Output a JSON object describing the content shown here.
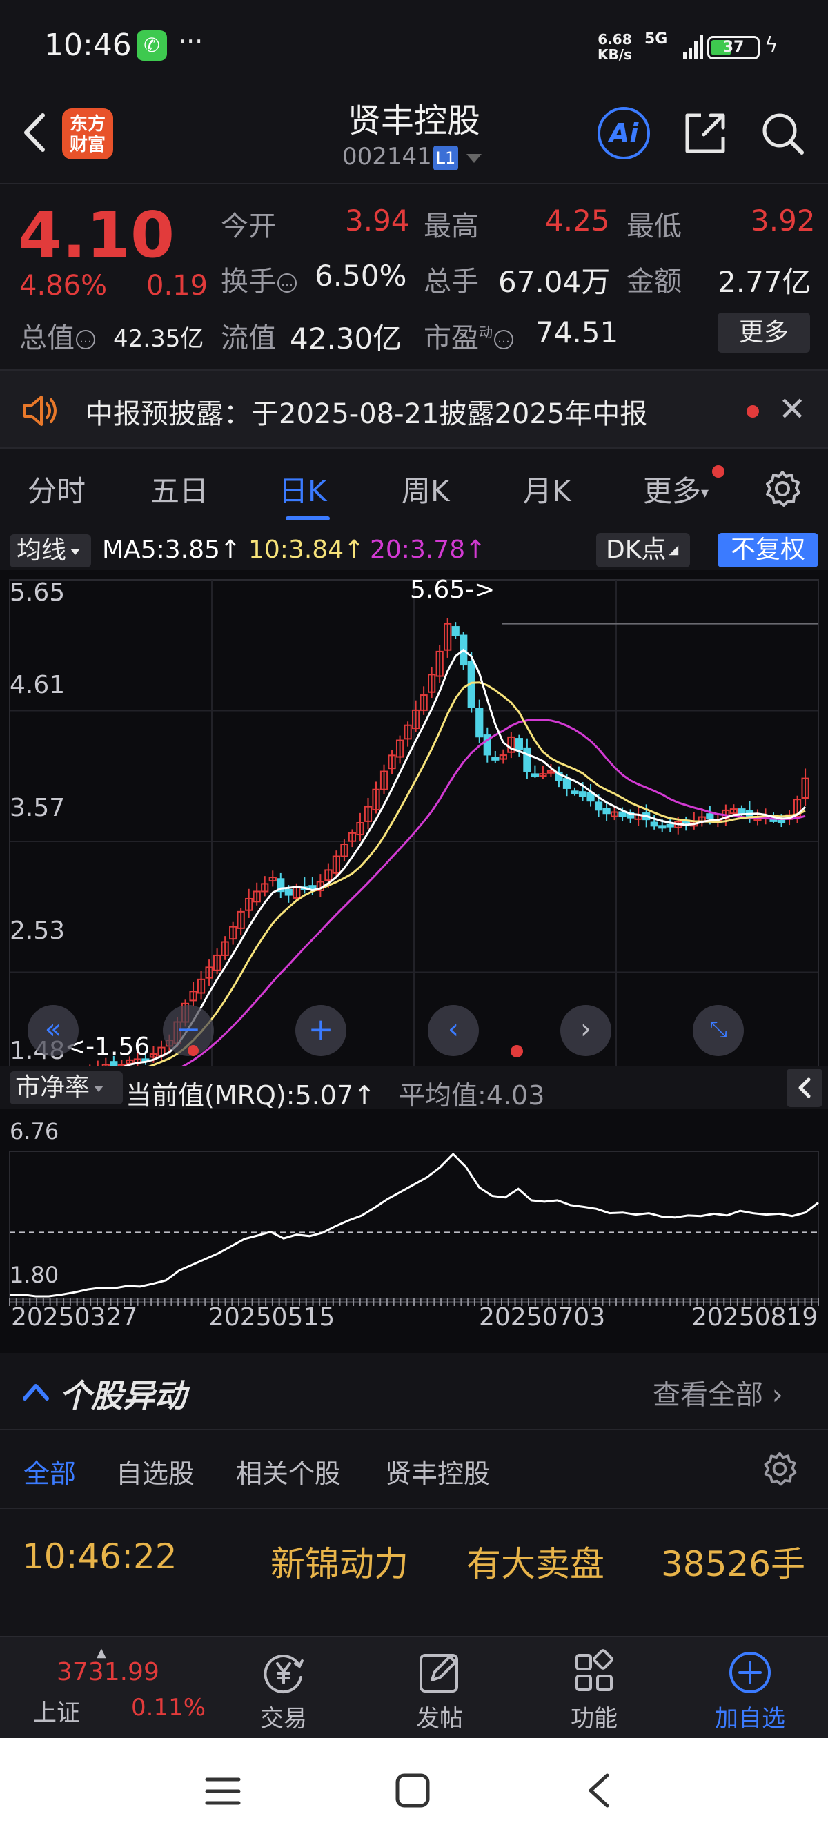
{
  "status_bar": {
    "time": "10:46",
    "more": "···",
    "net_speed": "6.68",
    "net_unit": "KB/s",
    "signal": "5G",
    "battery": "37"
  },
  "header": {
    "logo_line1": "东方",
    "logo_line2": "财富",
    "stock_name": "贤丰控股",
    "stock_code": "002141",
    "level_badge": "L1",
    "ai_label": "Ai"
  },
  "quote": {
    "price": "4.10",
    "change_pct": "4.86%",
    "change": "0.19",
    "open_label": "今开",
    "open": "3.94",
    "high_label": "最高",
    "high": "4.25",
    "low_label": "最低",
    "low": "3.92",
    "turnover_label": "换手",
    "turnover": "6.50%",
    "volume_label": "总手",
    "volume": "67.04万",
    "amount_label": "金额",
    "amount": "2.77亿",
    "mktcap_label": "总值",
    "mktcap": "42.35亿",
    "float_label": "流值",
    "float_cap": "42.30亿",
    "pe_label": "市盈",
    "pe_mark": "动",
    "pe": "74.51",
    "more_button": "更多"
  },
  "notice": {
    "text": "中报预披露：于2025-08-21披露2025年中报"
  },
  "tabs": {
    "items": [
      "分时",
      "五日",
      "日K",
      "周K",
      "月K",
      "更多"
    ],
    "active_index": 2
  },
  "chart_toolbar": {
    "indicator_button": "均线",
    "ma5": "MA5:3.85",
    "ma10": "10:3.84",
    "ma20": "20:3.78",
    "dk_button": "DK点",
    "adjust_button": "不复权"
  },
  "chart_data": [
    {
      "type": "candlestick",
      "y_tick_labels": [
        "5.65",
        "4.61",
        "3.57",
        "2.53",
        "1.48"
      ],
      "ylim": [
        1.48,
        5.65
      ],
      "high_annotation": "5.65->",
      "low_annotation": "<-1.56",
      "x_tick_labels": [
        "20250327",
        "20250515",
        "20250703",
        "20250819"
      ],
      "grid": true,
      "series": [
        {
          "name": "MA5",
          "last": 3.85,
          "color": "#ffffff"
        },
        {
          "name": "MA10",
          "last": 3.84,
          "color": "#f6e27a"
        },
        {
          "name": "MA20",
          "last": 3.78,
          "color": "#d23ad2"
        }
      ]
    },
    {
      "type": "line",
      "indicator_button": "市净率",
      "current_value": "当前值(MRQ):5.07",
      "average": "平均值:4.03",
      "y_tick_labels": [
        "6.76",
        "1.80"
      ],
      "ylim": [
        1.8,
        6.76
      ],
      "average_value": 4.03,
      "series": [
        {
          "color": "#ffffff",
          "values": [
            1.84,
            1.86,
            1.8,
            1.8,
            1.86,
            1.94,
            2.04,
            2.1,
            2.08,
            2.16,
            2.14,
            2.24,
            2.36,
            2.7,
            2.9,
            3.1,
            3.3,
            3.55,
            3.8,
            3.92,
            4.05,
            3.82,
            3.95,
            3.9,
            4.02,
            4.25,
            4.45,
            4.62,
            4.9,
            5.2,
            5.45,
            5.7,
            5.95,
            6.3,
            6.76,
            6.3,
            5.6,
            5.3,
            5.25,
            5.55,
            5.15,
            5.1,
            5.15,
            4.98,
            4.92,
            4.85,
            4.7,
            4.72,
            4.65,
            4.7,
            4.58,
            4.55,
            4.62,
            4.6,
            4.68,
            4.62,
            4.78,
            4.7,
            4.65,
            4.68,
            4.6,
            4.72,
            5.07
          ]
        }
      ]
    }
  ],
  "sub_chart": {
    "indicator_button": "市净率",
    "current_value": "当前值(MRQ):5.07",
    "average": "平均值:4.03"
  },
  "movers": {
    "title": "个股异动",
    "view_all": "查看全部",
    "tabs": [
      "全部",
      "自选股",
      "相关个股",
      "贤丰控股"
    ],
    "row": {
      "time": "10:46:22",
      "stock": "新锦动力",
      "event": "有大卖盘",
      "qty": "38526手"
    }
  },
  "bottom_nav": {
    "index_value": "3731.99",
    "index_name": "上证",
    "index_pct": "0.11%",
    "items": [
      "交易",
      "发帖",
      "功能",
      "加自选"
    ]
  }
}
